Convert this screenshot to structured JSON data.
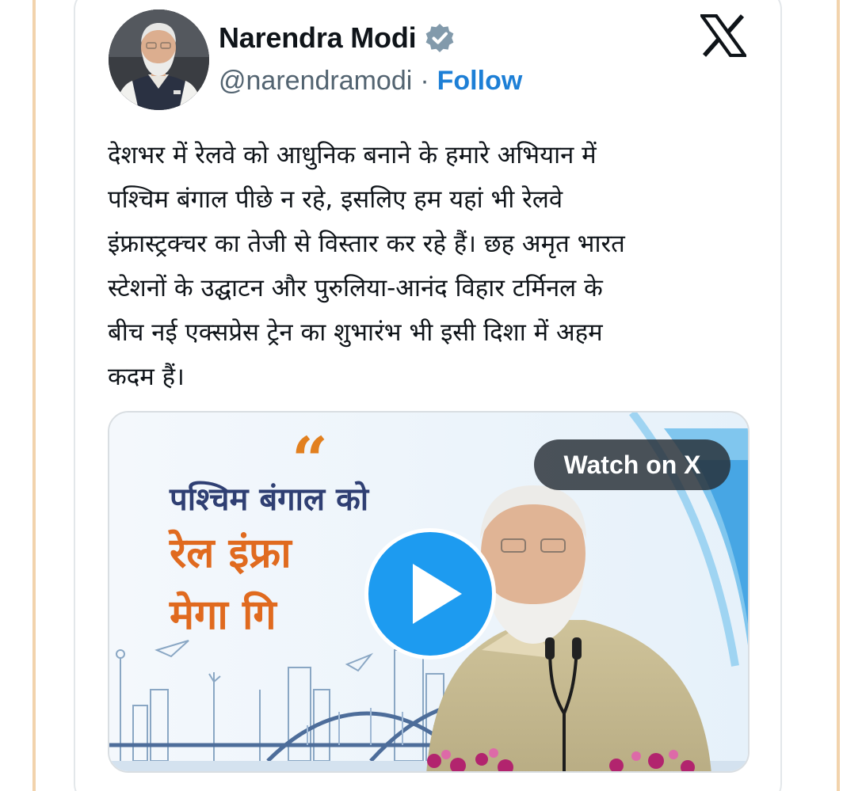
{
  "tweet": {
    "author_name": "Narendra Modi",
    "handle": "@narendramodi",
    "separator": "·",
    "follow_label": "Follow",
    "verified_icon": "verified-badge-icon",
    "platform_icon": "x-logo-icon",
    "text": "देशभर में रेलवे को आधुनिक बनाने के हमारे अभियान में\nपश्चिम बंगाल पीछे न रहे, इसलिए हम यहां भी रेलवे\nइंफ्रास्ट्रक्चर का तेजी से विस्तार कर रहे हैं। छह अमृत भारत\nस्टेशनों के उद्घाटन और पुरुलिया-आनंद विहार टर्मिनल के\nबीच नई एक्सप्रेस ट्रेन का शुभारंभ भी इसी दिशा में अहम\nकदम हैं।"
  },
  "media": {
    "type": "video",
    "watch_label": "Watch on X",
    "play_icon": "play-icon",
    "thumbnail_quote": "“",
    "thumbnail_line1": "पश्चिम बंगाल को",
    "thumbnail_line2": "रेल इंफ्रा",
    "thumbnail_line3": "मेगा गि"
  },
  "colors": {
    "accent": "#1d9bf0",
    "follow": "#1d7fd6",
    "text": "#0f1419",
    "muted": "#536471",
    "headline_orange": "#e06a1f",
    "headline_navy": "#2f3f73"
  }
}
